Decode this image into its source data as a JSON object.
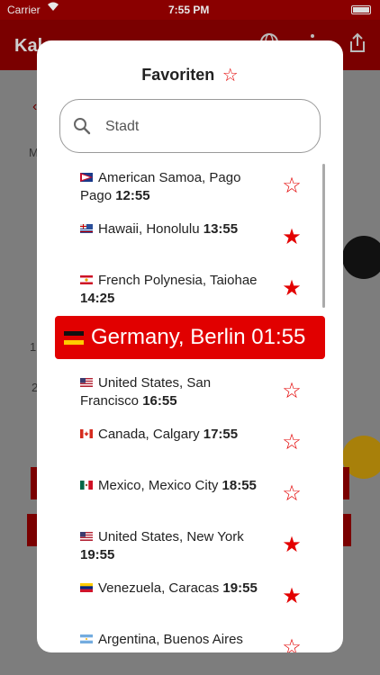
{
  "status_bar": {
    "carrier": "Carrier",
    "time": "7:55 PM"
  },
  "app": {
    "title": "Kal"
  },
  "modal": {
    "title": "Favoriten",
    "search_placeholder": "Stadt",
    "items": [
      {
        "city": "American Samoa, Pago Pago",
        "time": "12:55",
        "favorite": false,
        "flag": "as"
      },
      {
        "city": "Hawaii, Honolulu",
        "time": "13:55",
        "favorite": true,
        "flag": "hi"
      },
      {
        "city": "French Polynesia, Taiohae",
        "time": "14:25",
        "favorite": true,
        "flag": "pf"
      },
      {
        "city": "United States, San Francisco",
        "time": "16:55",
        "favorite": false,
        "flag": "us"
      },
      {
        "city": "Canada, Calgary",
        "time": "17:55",
        "favorite": false,
        "flag": "ca"
      },
      {
        "city": "Mexico, Mexico City",
        "time": "18:55",
        "favorite": false,
        "flag": "mx"
      },
      {
        "city": "United States, New York",
        "time": "19:55",
        "favorite": true,
        "flag": "us"
      },
      {
        "city": "Venezuela, Caracas",
        "time": "19:55",
        "favorite": true,
        "flag": "ve"
      },
      {
        "city": "Argentina, Buenos Aires",
        "time": "",
        "favorite": false,
        "flag": "ar"
      }
    ],
    "highlight": {
      "city": "Germany, Berlin",
      "time": "01:55",
      "flag": "de"
    }
  }
}
